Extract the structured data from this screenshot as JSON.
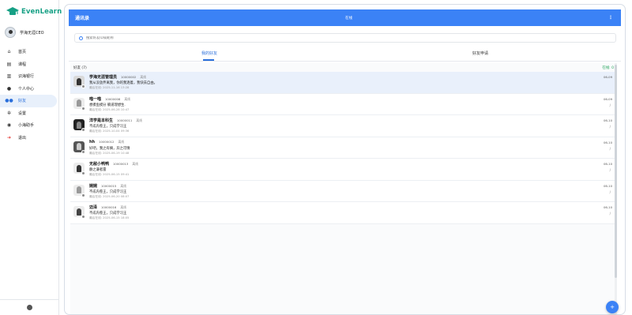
{
  "app": {
    "brand": "EvenLearn"
  },
  "user": {
    "name": "学海无涯CEO"
  },
  "sidebar": {
    "items": [
      {
        "label": "首页",
        "icon": "home-icon"
      },
      {
        "label": "课程",
        "icon": "book-icon"
      },
      {
        "label": "识海银行",
        "icon": "bank-icon"
      },
      {
        "label": "个人中心",
        "icon": "user-icon"
      },
      {
        "label": "好友",
        "icon": "friends-icon",
        "active": true
      },
      {
        "label": "设置",
        "icon": "gear-icon"
      },
      {
        "label": "小海助手",
        "icon": "chat-icon"
      },
      {
        "label": "退出",
        "icon": "logout-icon"
      }
    ]
  },
  "header": {
    "title": "通讯录",
    "status": "在线",
    "more": "⋮"
  },
  "search": {
    "placeholder": "搜索好友ID或昵称"
  },
  "tabs": {
    "friends": "我的好友",
    "requests": "好友申请"
  },
  "list_header": {
    "left": "好友 (7)",
    "right": "在线: 0"
  },
  "friends": [
    {
      "name": "学海无涯管理员",
      "id": "10000002",
      "status": "离线",
      "message": "我从没放弃离我，你的我逐着，我快去自由。",
      "last": "最后在线: 2025-11-16 13:28",
      "date": "06-09",
      "sub": ""
    },
    {
      "name": "喵一喵",
      "id": "10000008",
      "status": "离线",
      "message": "想摸鱼摸分 躺道理想生.",
      "last": "最后在线: 2025-06-28 10:47",
      "date": "06-09",
      "sub": "/"
    },
    {
      "name": "洋学是本科生",
      "id": "10000011",
      "status": "离线",
      "message": "不成内卷王，只成学习王",
      "last": "最后在线: 2025-10-04 09:36",
      "date": "06-10",
      "sub": "/"
    },
    {
      "name": "hh",
      "id": "10000012",
      "status": "离线",
      "message": "好吧，我之有摘，异之可情",
      "last": "最后在线: 2025-06-19 10:48",
      "date": "06-10",
      "sub": "/"
    },
    {
      "name": "无敌小鸭鸭",
      "id": "10000013",
      "status": "离线",
      "message": "静之谦者雷",
      "last": "最后在线: 2025-06-15 09:41",
      "date": "06-10",
      "sub": "/"
    },
    {
      "name": "婉婉",
      "id": "10000015",
      "status": "离线",
      "message": "不成内卷王，只成学习王",
      "last": "最后在线: 2025-06-20 08:07",
      "date": "06-10",
      "sub": "/"
    },
    {
      "name": "迈泽",
      "id": "10000016",
      "status": "离线",
      "message": "不成内卷王，只成学习王",
      "last": "最后在线: 2025-06-15 18:05",
      "date": "06-10",
      "sub": "/"
    }
  ],
  "fab": {
    "label": "+"
  },
  "colors": {
    "accent": "#3b82f6",
    "brand": "#16a085",
    "online": "#22a45a"
  }
}
